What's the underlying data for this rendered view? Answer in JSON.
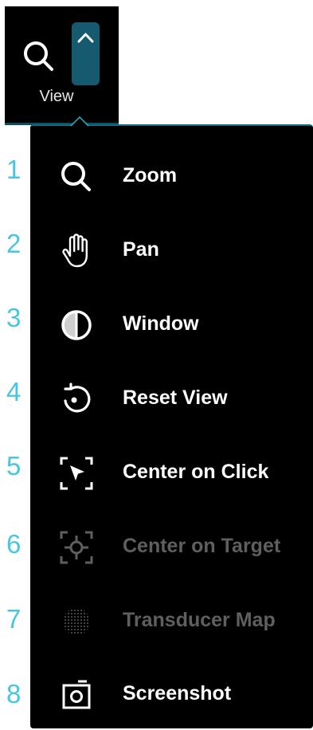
{
  "toolbar": {
    "view_label": "View",
    "zoom_icon": "magnifier-icon",
    "expand_icon": "chevron-up-icon",
    "colors": {
      "button_bg": "#000000",
      "chevron_bg": "#155a6e",
      "accent": "#48c6e0"
    }
  },
  "menu": {
    "items": [
      {
        "shortcut": "1",
        "label": "Zoom",
        "icon": "zoom-icon",
        "enabled": true
      },
      {
        "shortcut": "2",
        "label": "Pan",
        "icon": "hand-icon",
        "enabled": true
      },
      {
        "shortcut": "3",
        "label": "Window",
        "icon": "half-circle-icon",
        "enabled": true
      },
      {
        "shortcut": "4",
        "label": "Reset View",
        "icon": "reset-rotate-icon",
        "enabled": true
      },
      {
        "shortcut": "5",
        "label": "Center on Click",
        "icon": "cursor-target-icon",
        "enabled": true
      },
      {
        "shortcut": "6",
        "label": "Center on Target",
        "icon": "crosshair-target-icon",
        "enabled": false
      },
      {
        "shortcut": "7",
        "label": "Transducer Map",
        "icon": "dot-grid-icon",
        "enabled": false
      },
      {
        "shortcut": "8",
        "label": "Screenshot",
        "icon": "camera-icon",
        "enabled": true
      }
    ]
  }
}
